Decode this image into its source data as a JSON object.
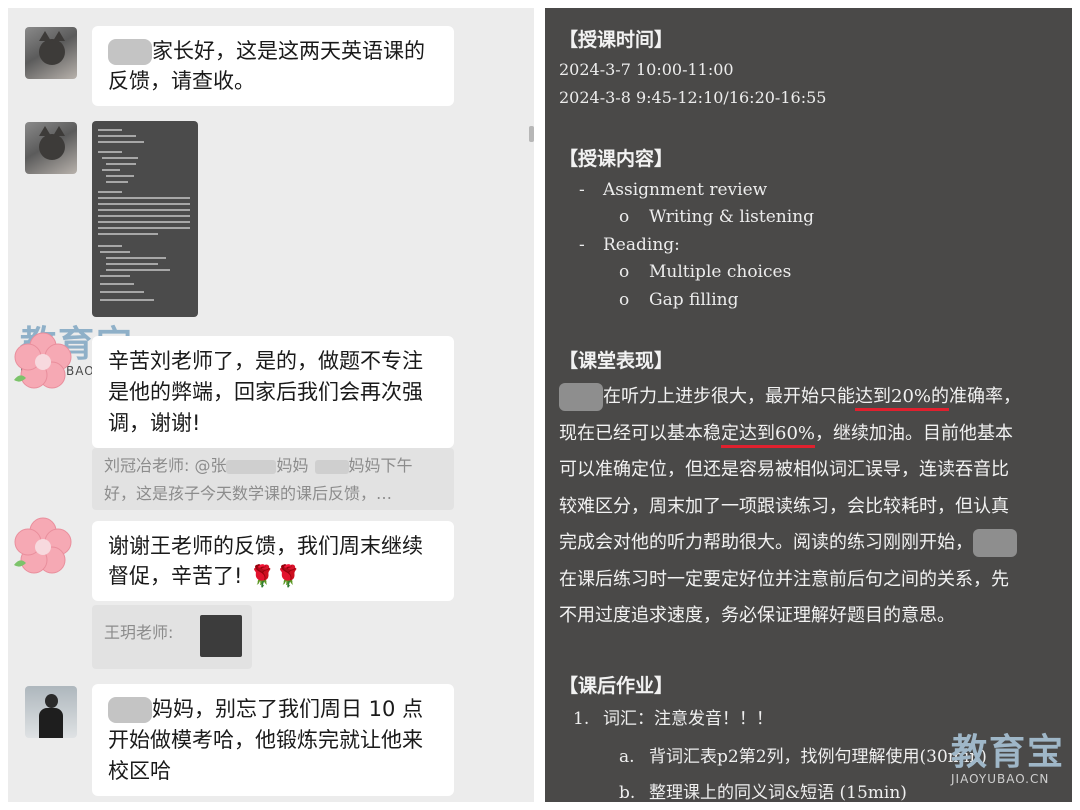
{
  "chat": {
    "messages": [
      {
        "line1": "家长好，这是这两天英语课的",
        "line2": "反馈，请查收。"
      },
      {
        "line1": "辛苦刘老师了，是的，做题不专注",
        "line2": "是他的弊端，回家后我们会再次强",
        "line3": "调，谢谢!"
      },
      {
        "line1": "谢谢王老师的反馈，我们周末继续",
        "line2": "督促，辛苦了! 🌹🌹"
      },
      {
        "line1": "妈妈，别忘了我们周日 10 点",
        "line2": "开始做模考哈，他锻炼完就让他来",
        "line3": "校区哈"
      }
    ],
    "quote1": {
      "line1a": "刘冠冶老师: @张",
      "line1b": "妈妈",
      "line1c": "妈妈下午",
      "line2": "好，这是孩子今天数学课的课后反馈，…"
    },
    "quote2": {
      "label": "王玥老师:"
    },
    "watermark": {
      "title": "教育宝",
      "url": "JIAOYUBAO.CN"
    }
  },
  "doc": {
    "sections": {
      "time": "【授课时间】",
      "content": "【授课内容】",
      "performance": "【课堂表现】",
      "homework": "【课后作业】"
    },
    "times": [
      "2024-3-7 10:00-11:00",
      "2024-3-8 9:45-12:10/16:20-16:55"
    ],
    "content": {
      "item1": "Assignment review",
      "item1_sub": "Writing & listening",
      "item2": "Reading:",
      "item2_sub1": "Multiple choices",
      "item2_sub2": "Gap filling",
      "dash": "-",
      "circle": "o"
    },
    "performance": {
      "p1a": "在听力上进步很大，最开始只能",
      "p1u": "达到20%的",
      "p1b": "准确率，",
      "p2a": "现在已经可以基本稳",
      "p2u": "定达到60%",
      "p2b": "，继续加油。目前他基本",
      "p3": "可以准确定位，但还是容易被相似词汇误导，连读吞音比",
      "p4": "较难区分，周末加了一项跟读练习，会比较耗时，但认真",
      "p5": "完成会对他的听力帮助很大。阅读的练习刚刚开始，",
      "p6": "在课后练习时一定要定好位并注意前后句之间的关系，先",
      "p7": "不用过度追求速度，务必保证理解好题目的意思。"
    },
    "homework": {
      "n1": "1.",
      "item1": "词汇：注意发音！！！",
      "a": "a.",
      "item_a": "背词汇表p2第2列，找例句理解使用(30min)",
      "b": "b.",
      "item_b": "整理课上的同义词&短语 (15min)"
    },
    "watermark": {
      "title": "教育宝",
      "url": "JIAOYUBAO.CN"
    }
  }
}
